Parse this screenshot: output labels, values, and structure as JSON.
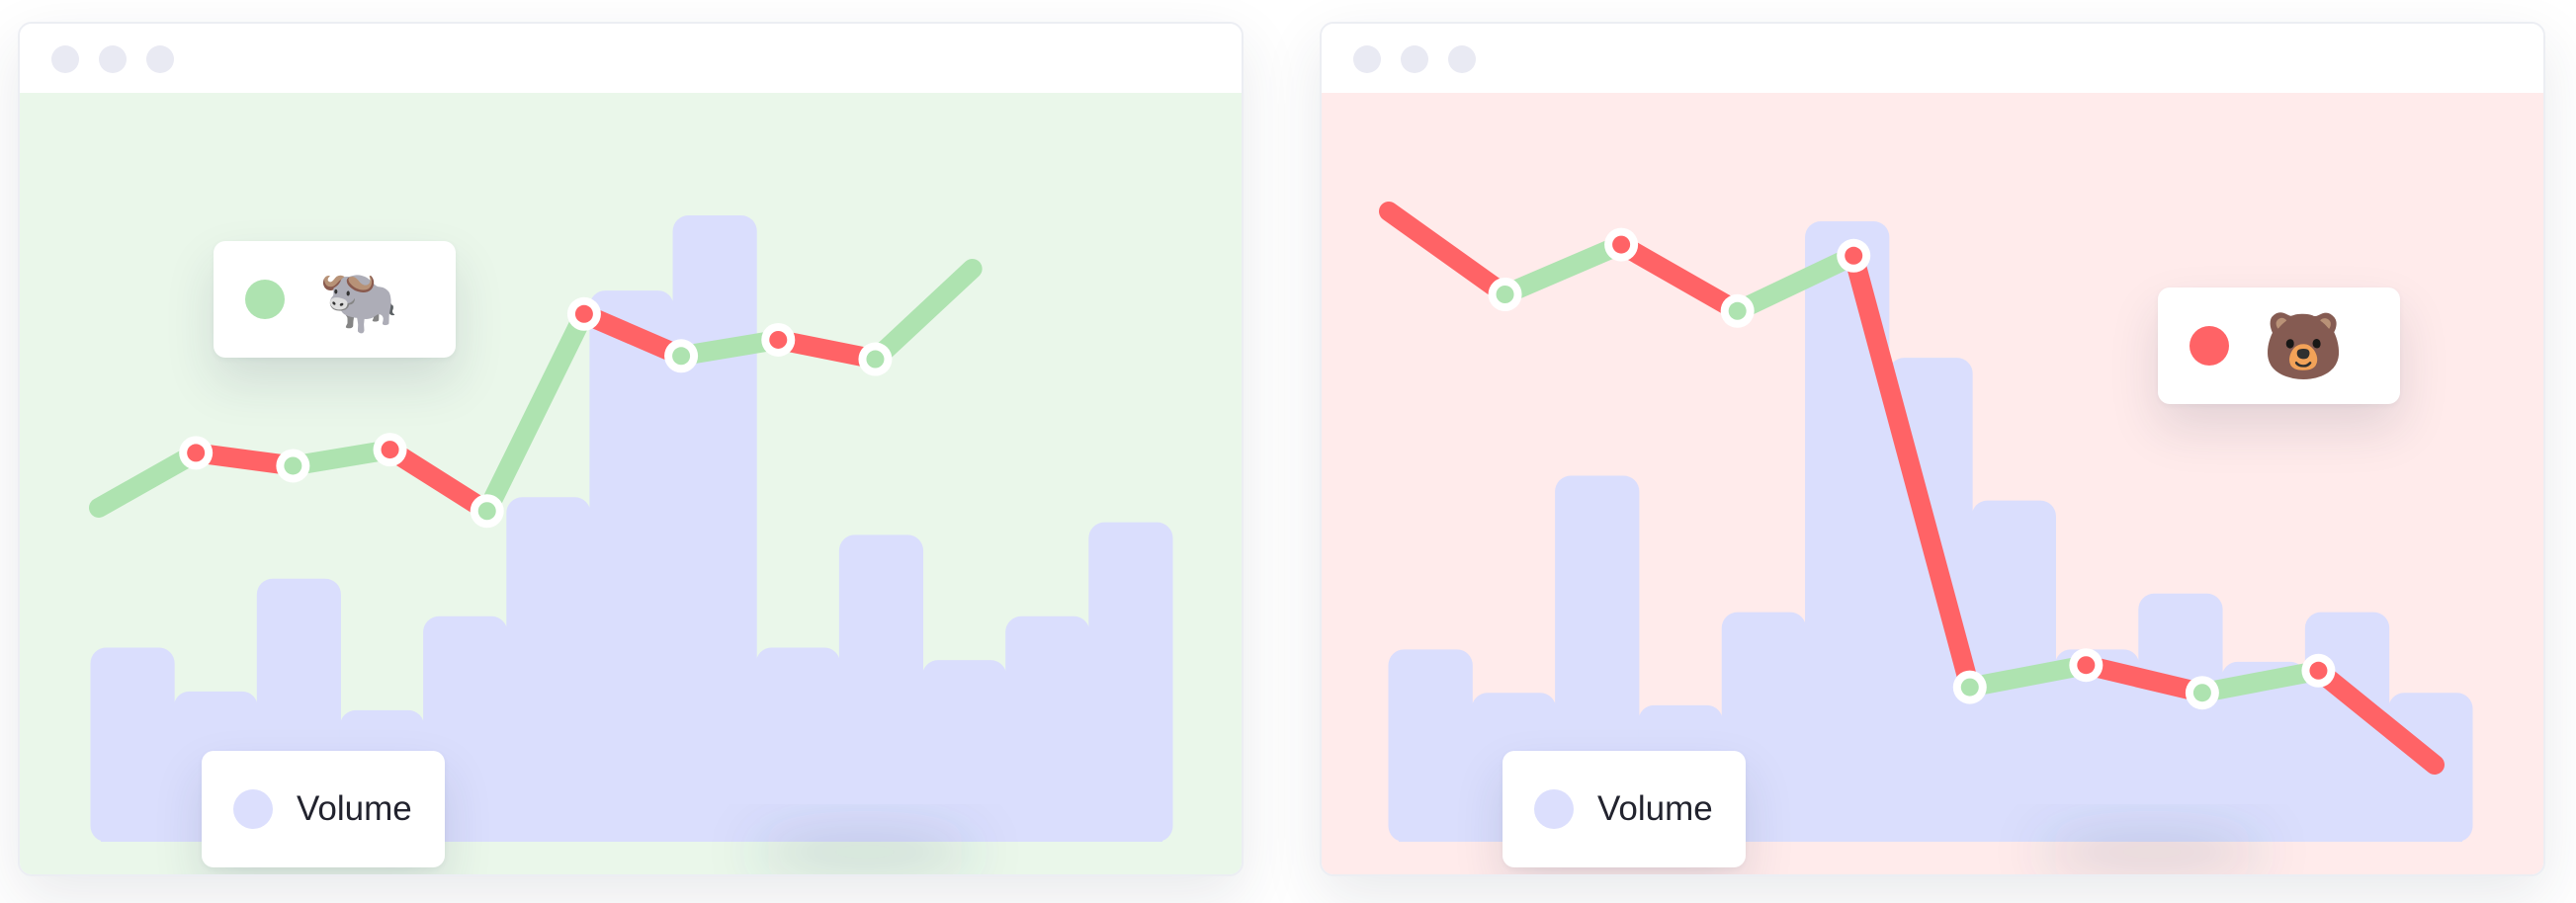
{
  "colors": {
    "up": "#aee3b0",
    "down": "#ff6366",
    "volume": "#dadefd",
    "volume_dot": "#dcdffd",
    "bull_bg": "#eaf7ea",
    "bear_bg": "#ffebeb"
  },
  "chart_data": [
    {
      "type": "line",
      "title": "",
      "xlabel": "",
      "ylabel": "",
      "legend": [
        {
          "label": "🐃",
          "icon": "water-buffalo-emoji",
          "color": "#aee3b0"
        },
        {
          "label": "Volume",
          "color": "#dadefd"
        }
      ],
      "ylim": [
        0,
        100
      ],
      "volume_ylim": [
        0,
        100
      ],
      "price": {
        "x": [
          0,
          1,
          2,
          3,
          4,
          5,
          6,
          7,
          8,
          9,
          10
        ],
        "y": [
          26,
          43,
          39,
          44,
          25,
          86,
          73,
          78,
          72,
          100,
          null
        ],
        "markers": [
          {
            "x": 1,
            "color": "red"
          },
          {
            "x": 2,
            "color": "green"
          },
          {
            "x": 3,
            "color": "red"
          },
          {
            "x": 4,
            "color": "green"
          },
          {
            "x": 5,
            "color": "red"
          },
          {
            "x": 6,
            "color": "green"
          },
          {
            "x": 7,
            "color": "red"
          },
          {
            "x": 8,
            "color": "green"
          }
        ]
      },
      "volume": {
        "x": [
          0,
          1,
          2,
          3,
          4,
          5,
          6,
          7,
          8,
          9,
          10
        ],
        "values": [
          31,
          24,
          42,
          21,
          36,
          55,
          88,
          100,
          31,
          49,
          29,
          36,
          51
        ]
      }
    },
    {
      "type": "line",
      "title": "",
      "xlabel": "",
      "ylabel": "",
      "legend": [
        {
          "label": "🐻",
          "icon": "bear-face-emoji",
          "color": "#ff6366"
        },
        {
          "label": "Volume",
          "color": "#dadefd"
        }
      ],
      "ylim": [
        0,
        100
      ],
      "volume_ylim": [
        0,
        100
      ],
      "price": {
        "x": [
          0,
          1,
          2,
          3,
          4,
          5,
          6,
          7,
          8,
          9
        ],
        "y": [
          100,
          85,
          94,
          82,
          92,
          14,
          18,
          13,
          17,
          0
        ],
        "markers": [
          {
            "x": 1,
            "color": "green"
          },
          {
            "x": 2,
            "color": "red"
          },
          {
            "x": 3,
            "color": "green"
          },
          {
            "x": 4,
            "color": "red"
          },
          {
            "x": 5,
            "color": "green"
          },
          {
            "x": 6,
            "color": "red"
          },
          {
            "x": 7,
            "color": "green"
          },
          {
            "x": 8,
            "color": "red"
          }
        ]
      },
      "volume": {
        "values": [
          31,
          24,
          59,
          22,
          37,
          100,
          78,
          55,
          31,
          40,
          29,
          37,
          24
        ]
      }
    }
  ],
  "legend_bull": {
    "emoji": "🐃",
    "icon": "water-buffalo-emoji",
    "volume_label": "Volume"
  },
  "legend_bear": {
    "emoji": "🐻",
    "icon": "bear-face-emoji",
    "volume_label": "Volume"
  }
}
